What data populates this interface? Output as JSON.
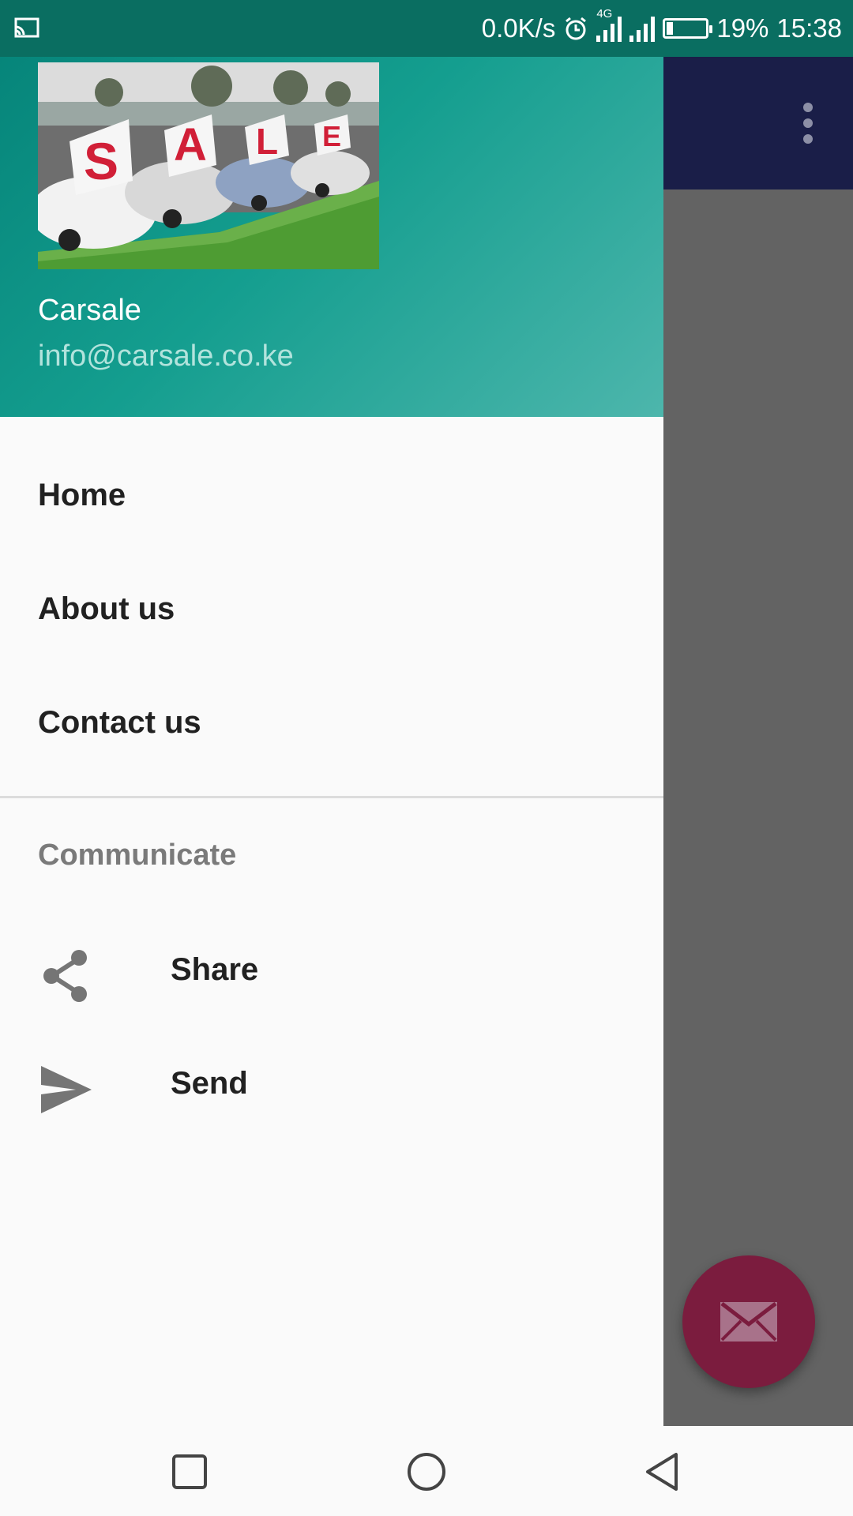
{
  "status_bar": {
    "net_speed": "0.0K/s",
    "network_type": "4G",
    "battery": "19%",
    "time": "15:38",
    "icons": [
      "screen-cast-icon",
      "alarm-icon",
      "signal-icon",
      "signal-icon",
      "battery-icon"
    ]
  },
  "drawer": {
    "header": {
      "name": "Carsale",
      "email": "info@carsale.co.ke",
      "image_signs": [
        "S",
        "A",
        "L",
        "E"
      ]
    },
    "menu_items": [
      {
        "label": "Home"
      },
      {
        "label": "About us"
      },
      {
        "label": "Contact us"
      }
    ],
    "section_title": "Communicate",
    "section_items": [
      {
        "label": "Share",
        "icon": "share-icon"
      },
      {
        "label": "Send",
        "icon": "send-icon"
      }
    ]
  },
  "app": {
    "toolbar_icon": "more-vert-icon",
    "fab_icon": "mail-icon"
  },
  "navigation_bar": {
    "buttons": [
      "recents-button",
      "home-button",
      "back-button"
    ]
  },
  "colors": {
    "status_bar": "#0a6e61",
    "drawer_header_start": "#06857a",
    "drawer_header_end": "#4db6ac",
    "app_bar": "#1a1e48",
    "fab": "#7b1c3e",
    "scrim": "#636363"
  }
}
